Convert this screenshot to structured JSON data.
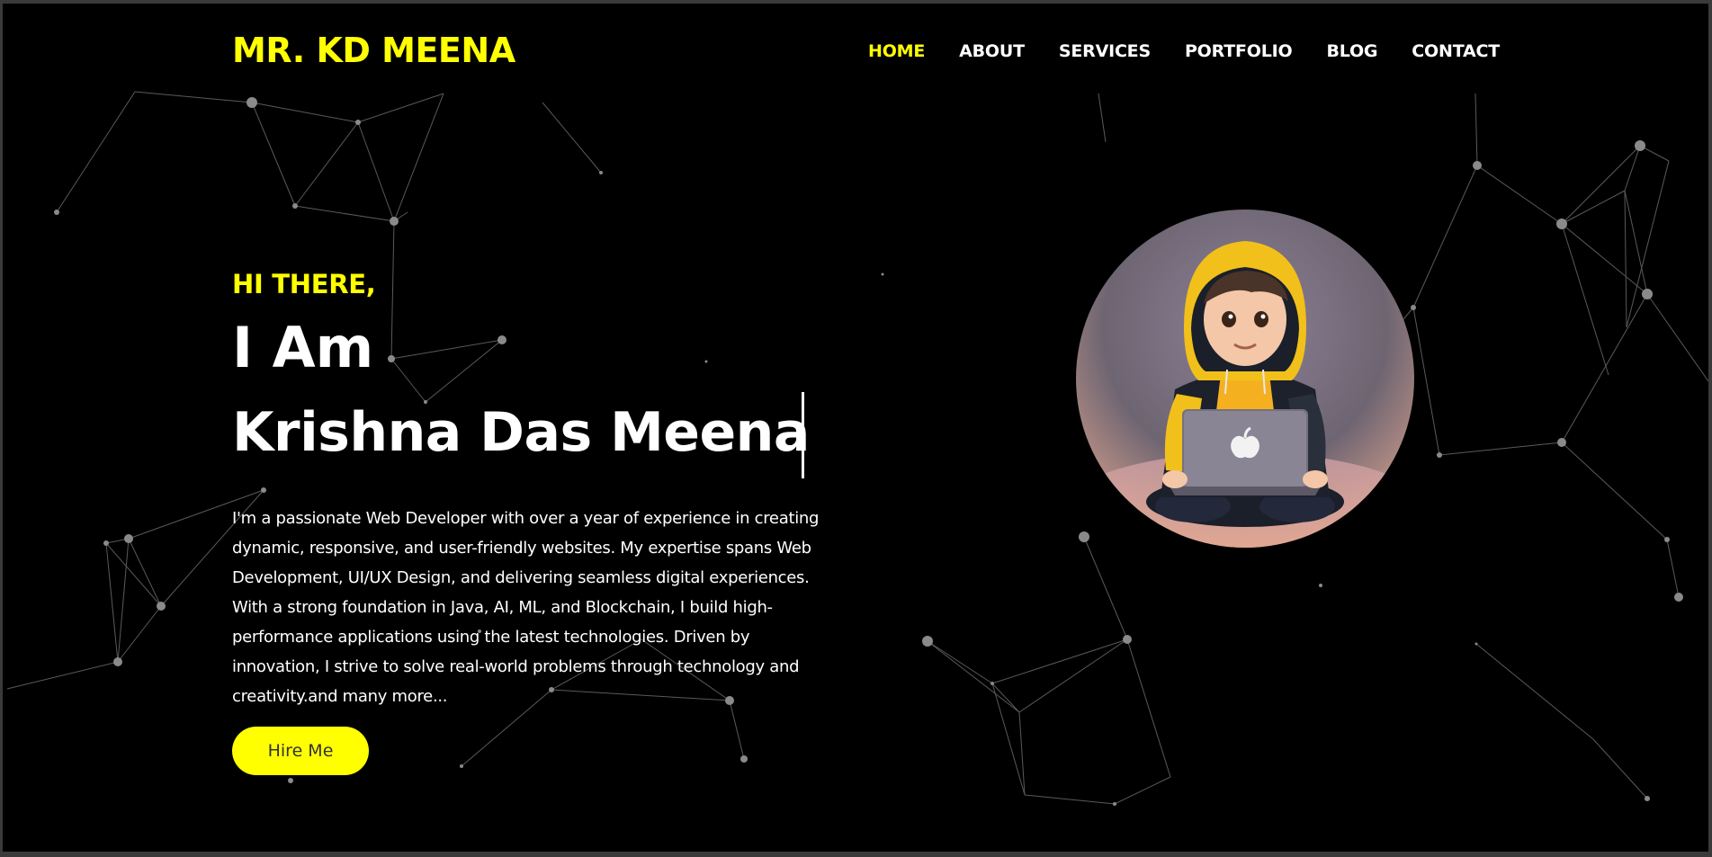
{
  "header": {
    "logo": "MR. KD MEENA",
    "nav": [
      {
        "label": "HOME",
        "active": true
      },
      {
        "label": "ABOUT",
        "active": false
      },
      {
        "label": "SERVICES",
        "active": false
      },
      {
        "label": "PORTFOLIO",
        "active": false
      },
      {
        "label": "BLOG",
        "active": false
      },
      {
        "label": "CONTACT",
        "active": false
      }
    ]
  },
  "hero": {
    "greeting": "HI THERE,",
    "intro": "I Am",
    "name": "Krishna Das Meena",
    "bio": "I'm a passionate Web Developer with over a year of experience in creating dynamic, responsive, and user-friendly websites. My expertise spans Web Development, UI/UX Design, and delivering seamless digital experiences. With a strong foundation in Java, AI, ML, and Blockchain, I build high-performance applications using the latest technologies. Driven by innovation, I strive to solve real-world problems through technology and creativity.and many more...",
    "cta": "Hire Me"
  },
  "colors": {
    "accent": "#ffff00",
    "background": "#000000",
    "text": "#ffffff"
  },
  "icons": {
    "avatar": "hooded-developer-with-laptop-illustration"
  }
}
